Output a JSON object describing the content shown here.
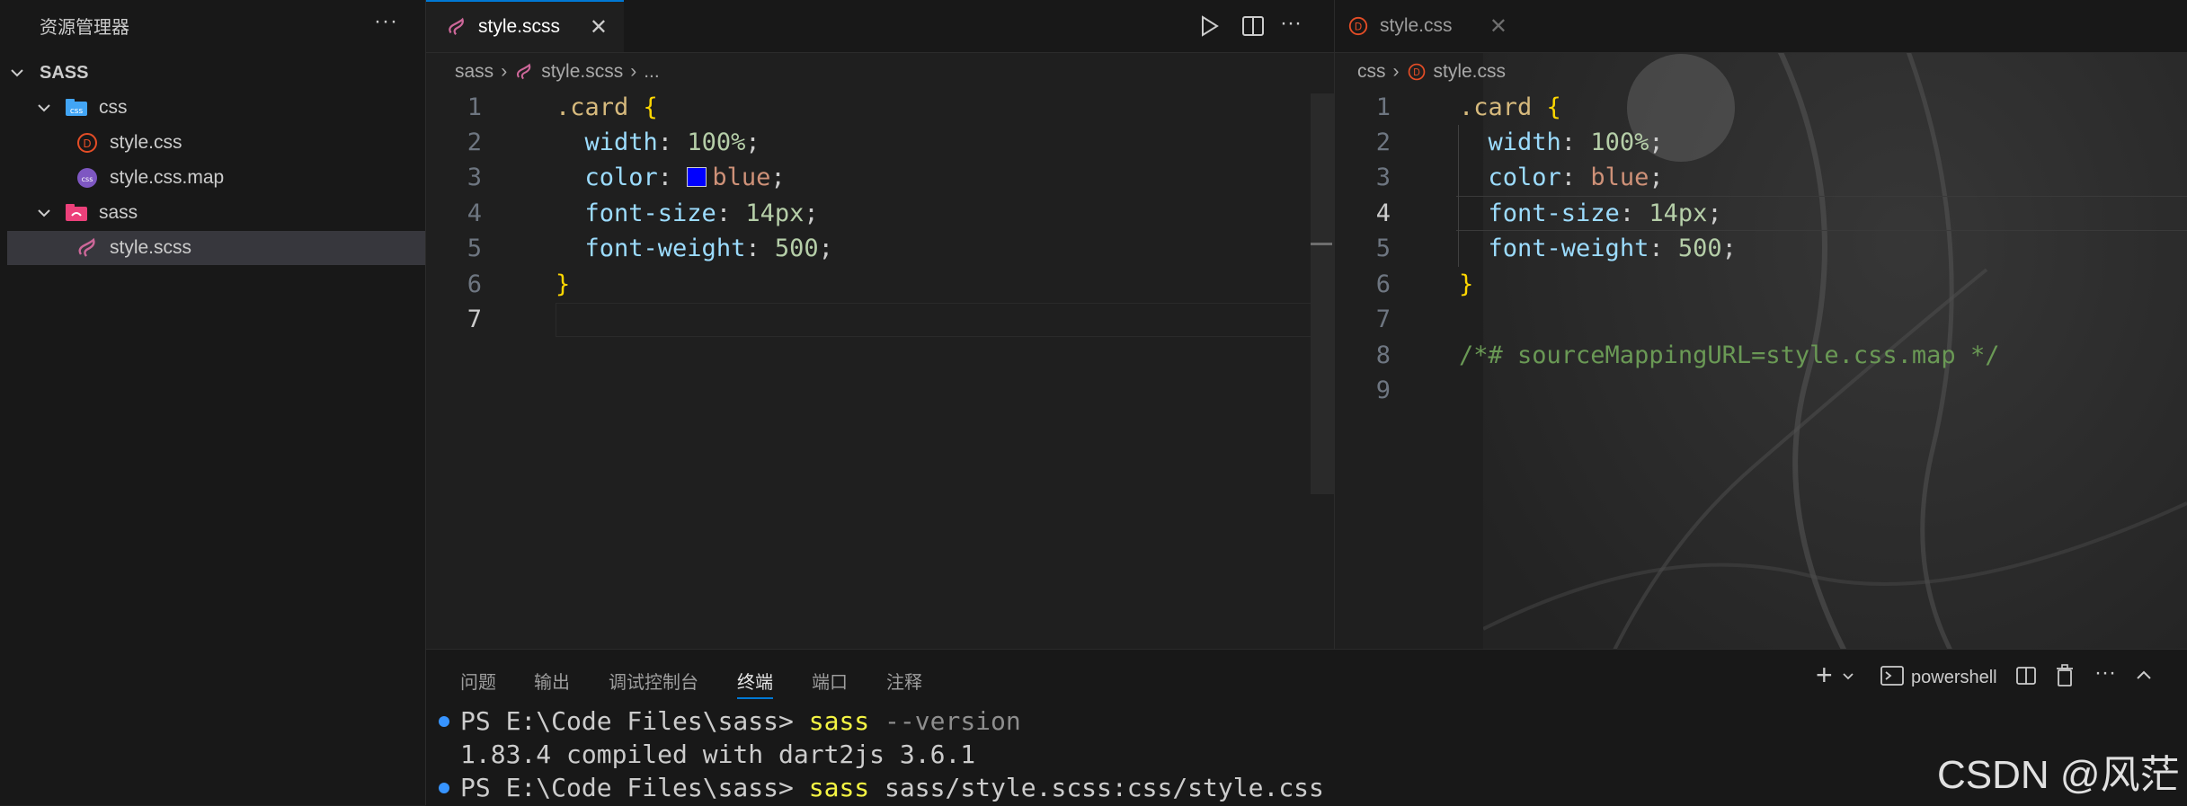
{
  "sidebar": {
    "title": "资源管理器",
    "more": "···",
    "root": "SASS",
    "items": [
      {
        "label": "css"
      },
      {
        "label": "style.css"
      },
      {
        "label": "style.css.map"
      },
      {
        "label": "sass"
      },
      {
        "label": "style.scss"
      }
    ]
  },
  "left_editor": {
    "tab": "style.scss",
    "tab_close": "✕",
    "breadcrumb": [
      "sass",
      "style.scss",
      "..."
    ],
    "lines": [
      "1",
      "2",
      "3",
      "4",
      "5",
      "6",
      "7"
    ],
    "code": {
      "l1_sel": ".card",
      "l1_brace": "{",
      "l2_prop": "width",
      "l2_val": "100%",
      "l3_prop": "color",
      "l3_val": "blue",
      "l4_prop": "font-size",
      "l4_val": "14px",
      "l5_prop": "font-weight",
      "l5_val": "500",
      "l6_brace": "}"
    },
    "color_swatch": "#0000ff"
  },
  "right_editor": {
    "tab": "style.css",
    "tab_close": "✕",
    "breadcrumb": [
      "css",
      "style.css"
    ],
    "lines": [
      "1",
      "2",
      "3",
      "4",
      "5",
      "6",
      "7",
      "8",
      "9"
    ],
    "code": {
      "l1_sel": ".card",
      "l1_brace": "{",
      "l2_prop": "width",
      "l2_val": "100%",
      "l3_prop": "color",
      "l3_val": "blue",
      "l4_prop": "font-size",
      "l4_val": "14px",
      "l5_prop": "font-weight",
      "l5_val": "500",
      "l6_brace": "}",
      "l8_comment": "/*# sourceMappingURL=style.css.map */"
    }
  },
  "panel": {
    "tabs": [
      "问题",
      "输出",
      "调试控制台",
      "终端",
      "端口",
      "注释"
    ],
    "active_tab": "终端",
    "shell": "powershell",
    "terminal": {
      "prompt1": "PS E:\\Code Files\\sass>",
      "cmd1": "sass",
      "arg1": "--version",
      "out1": "1.83.4 compiled with dart2js 3.6.1",
      "prompt2": "PS E:\\Code Files\\sass>",
      "cmd2": "sass",
      "arg2": "sass/style.scss:css/style.css"
    }
  },
  "watermark": "CSDN @风茫",
  "colors": {
    "accent": "#0078d4",
    "sass_pink": "#cd6799",
    "css_red": "#e44d26"
  }
}
